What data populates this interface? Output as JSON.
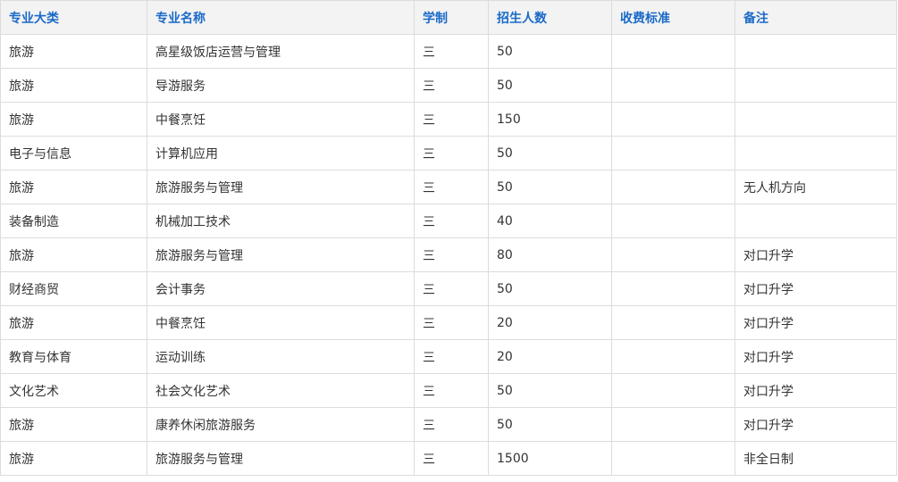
{
  "table": {
    "headers": [
      "专业大类",
      "专业名称",
      "学制",
      "招生人数",
      "收费标准",
      "备注"
    ],
    "rows": [
      [
        "旅游",
        "高星级饭店运营与管理",
        "三",
        "50",
        "",
        ""
      ],
      [
        "旅游",
        "导游服务",
        "三",
        "50",
        "",
        ""
      ],
      [
        "旅游",
        "中餐烹饪",
        "三",
        "150",
        "",
        ""
      ],
      [
        "电子与信息",
        "计算机应用",
        "三",
        "50",
        "",
        ""
      ],
      [
        "旅游",
        "旅游服务与管理",
        "三",
        "50",
        "",
        "无人机方向"
      ],
      [
        "装备制造",
        "机械加工技术",
        "三",
        "40",
        "",
        ""
      ],
      [
        "旅游",
        "旅游服务与管理",
        "三",
        "80",
        "",
        "对口升学"
      ],
      [
        "财经商贸",
        "会计事务",
        "三",
        "50",
        "",
        "对口升学"
      ],
      [
        "旅游",
        "中餐烹饪",
        "三",
        "20",
        "",
        "对口升学"
      ],
      [
        "教育与体育",
        "运动训练",
        "三",
        "20",
        "",
        "对口升学"
      ],
      [
        "文化艺术",
        "社会文化艺术",
        "三",
        "50",
        "",
        "对口升学"
      ],
      [
        "旅游",
        "康养休闲旅游服务",
        "三",
        "50",
        "",
        "对口升学"
      ],
      [
        "旅游",
        "旅游服务与管理",
        "三",
        "1500",
        "",
        "非全日制"
      ]
    ]
  },
  "colors": {
    "header_text": "#1a6ac8",
    "header_bg": "#f3f3f3",
    "border": "#dcdcdc",
    "body_text": "#333333"
  }
}
